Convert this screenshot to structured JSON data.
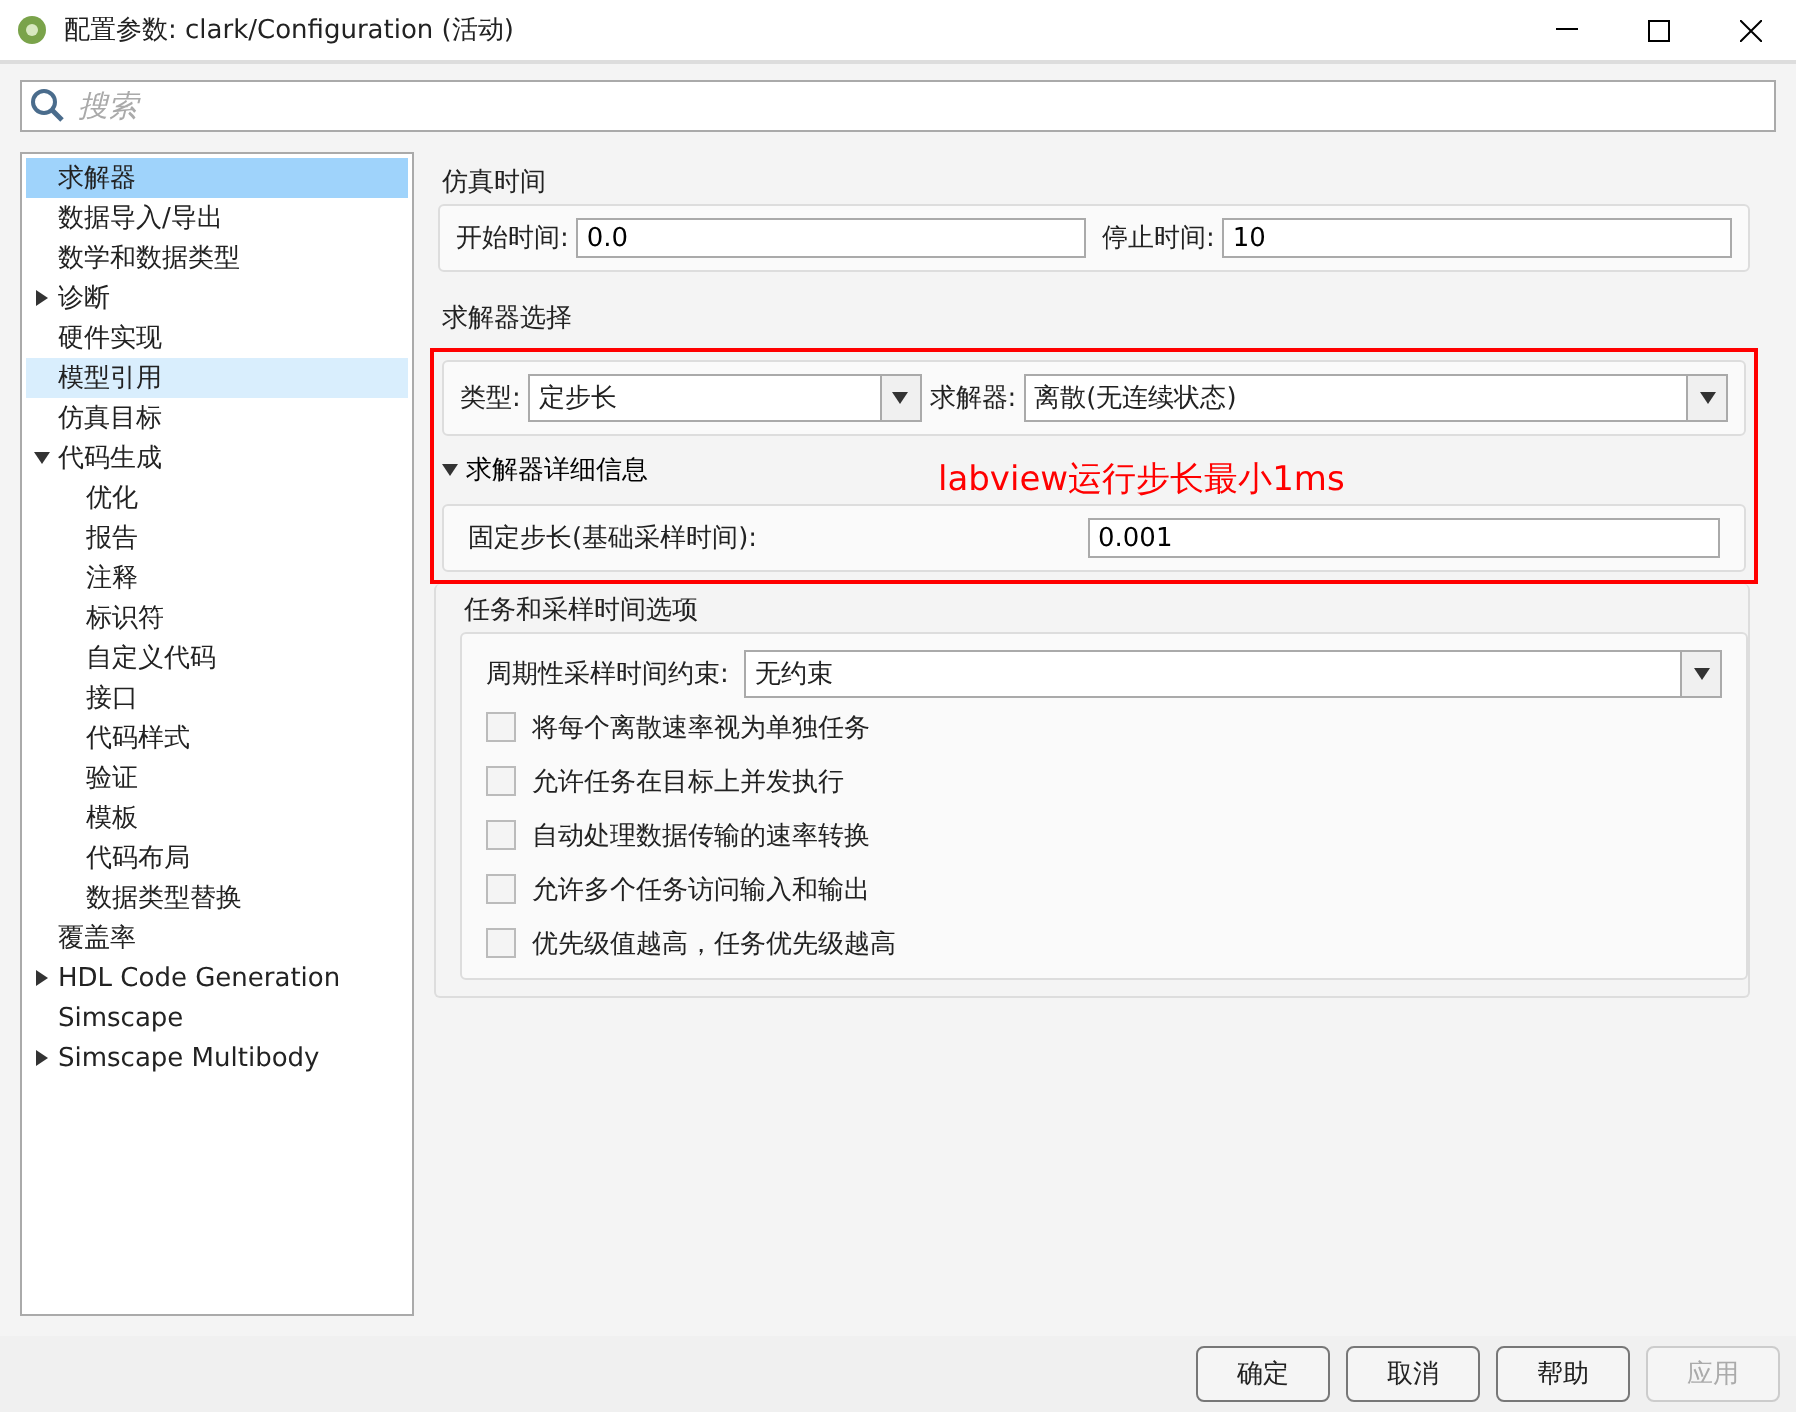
{
  "window": {
    "title": "配置参数: clark/Configuration (活动)"
  },
  "search": {
    "placeholder": "搜索"
  },
  "sidebar": {
    "items": [
      {
        "label": "求解器",
        "selected": true,
        "hovered": false
      },
      {
        "label": "数据导入/导出",
        "selected": false,
        "hovered": false
      },
      {
        "label": "数学和数据类型",
        "selected": false,
        "hovered": false
      },
      {
        "label": "诊断",
        "selected": false,
        "hovered": false,
        "expanded": false
      },
      {
        "label": "硬件实现",
        "selected": false,
        "hovered": false
      },
      {
        "label": "模型引用",
        "selected": false,
        "hovered": true
      },
      {
        "label": "仿真目标",
        "selected": false,
        "hovered": false
      },
      {
        "label": "代码生成",
        "selected": false,
        "hovered": false,
        "expanded": true,
        "children": [
          {
            "label": "优化",
            "selected": false,
            "hovered": false
          },
          {
            "label": "报告",
            "selected": false,
            "hovered": false
          },
          {
            "label": "注释",
            "selected": false,
            "hovered": false
          },
          {
            "label": "标识符",
            "selected": false,
            "hovered": false
          },
          {
            "label": "自定义代码",
            "selected": false,
            "hovered": false
          },
          {
            "label": "接口",
            "selected": false,
            "hovered": false
          },
          {
            "label": "代码样式",
            "selected": false,
            "hovered": false
          },
          {
            "label": "验证",
            "selected": false,
            "hovered": false
          },
          {
            "label": "模板",
            "selected": false,
            "hovered": false
          },
          {
            "label": "代码布局",
            "selected": false,
            "hovered": false
          },
          {
            "label": "数据类型替换",
            "selected": false,
            "hovered": false
          }
        ]
      },
      {
        "label": "覆盖率",
        "selected": false,
        "hovered": false
      },
      {
        "label": "HDL Code Generation",
        "selected": false,
        "hovered": false,
        "expanded": false
      },
      {
        "label": "Simscape",
        "selected": false,
        "hovered": false
      },
      {
        "label": "Simscape Multibody",
        "selected": false,
        "hovered": false,
        "expanded": false
      }
    ]
  },
  "simulation_time": {
    "title": "仿真时间",
    "start_label": "开始时间:",
    "start_value": "0.0",
    "stop_label": "停止时间:",
    "stop_value": "10"
  },
  "solver_selection": {
    "title": "求解器选择",
    "type_label": "类型:",
    "type_value": "定步长",
    "solver_label": "求解器:",
    "solver_value": "离散(无连续状态)",
    "details": {
      "title": "求解器详细信息",
      "expanded": true,
      "step_label": "固定步长(基础采样时间):",
      "step_value": "0.001"
    }
  },
  "annotation": {
    "text": "labview运行步长最小1ms"
  },
  "tasks": {
    "title": "任务和采样时间选项",
    "constraint_label": "周期性采样时间约束:",
    "constraint_value": "无约束",
    "options": [
      {
        "label": "将每个离散速率视为单独任务",
        "checked": false
      },
      {
        "label": "允许任务在目标上并发执行",
        "checked": false
      },
      {
        "label": "自动处理数据传输的速率转换",
        "checked": false
      },
      {
        "label": "允许多个任务访问输入和输出",
        "checked": false
      },
      {
        "label": "优先级值越高，任务优先级越高",
        "checked": false
      }
    ]
  },
  "buttons": [
    {
      "label": "确定",
      "disabled": false
    },
    {
      "label": "取消",
      "disabled": false
    },
    {
      "label": "帮助",
      "disabled": false
    },
    {
      "label": "应用",
      "disabled": true
    }
  ]
}
